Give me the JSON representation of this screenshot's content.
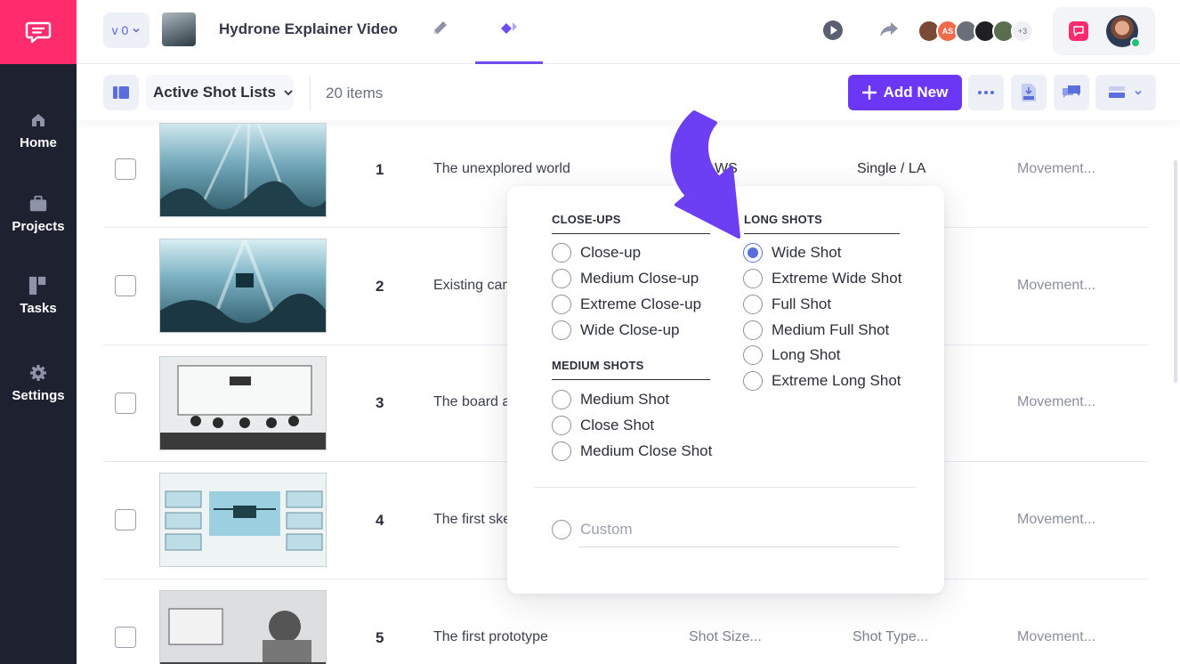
{
  "sidebar": {
    "items": [
      {
        "label": "Home",
        "icon": "home-icon"
      },
      {
        "label": "Projects",
        "icon": "briefcase-icon"
      },
      {
        "label": "Tasks",
        "icon": "tasks-icon"
      },
      {
        "label": "Settings",
        "icon": "gear-icon"
      }
    ]
  },
  "header": {
    "version": "v 0",
    "project_title": "Hydrone Explainer Video",
    "avatars": [
      "",
      "AS",
      "",
      "",
      ""
    ],
    "more_collaborators": "+3"
  },
  "toolbar": {
    "list_select": "Active Shot Lists",
    "item_count": "20 items",
    "add_new": "Add New"
  },
  "rows": [
    {
      "num": "1",
      "desc": "The unexplored world",
      "size": "WS",
      "type": "Single / LA",
      "move": "Movement..."
    },
    {
      "num": "2",
      "desc": "Existing cam",
      "size": "",
      "type": "",
      "move": "Movement..."
    },
    {
      "num": "3",
      "desc": "The board a",
      "size": "",
      "type": "",
      "move": "Movement..."
    },
    {
      "num": "4",
      "desc": "The first ske",
      "size": "",
      "type": "",
      "move": "Movement..."
    },
    {
      "num": "5",
      "desc": "The first prototype",
      "size": "Shot Size...",
      "type": "Shot Type...",
      "move": "Movement..."
    }
  ],
  "popup": {
    "closeups": {
      "title": "CLOSE-UPS",
      "options": [
        "Close-up",
        "Medium Close-up",
        "Extreme Close-up",
        "Wide Close-up"
      ]
    },
    "medium": {
      "title": "MEDIUM SHOTS",
      "options": [
        "Medium Shot",
        "Close Shot",
        "Medium Close Shot"
      ]
    },
    "long": {
      "title": "LONG SHOTS",
      "options": [
        "Wide Shot",
        "Extreme Wide Shot",
        "Full Shot",
        "Medium Full Shot",
        "Long Shot",
        "Extreme Long Shot"
      ],
      "selected": "Wide Shot"
    },
    "custom_placeholder": "Custom"
  },
  "colors": {
    "brand_pink": "#ff2c6d",
    "sidebar_bg": "#1e2130",
    "accent_purple": "#6b37f5",
    "arrow_purple": "#6d3ff2",
    "radio_selected": "#5b6fdc"
  }
}
